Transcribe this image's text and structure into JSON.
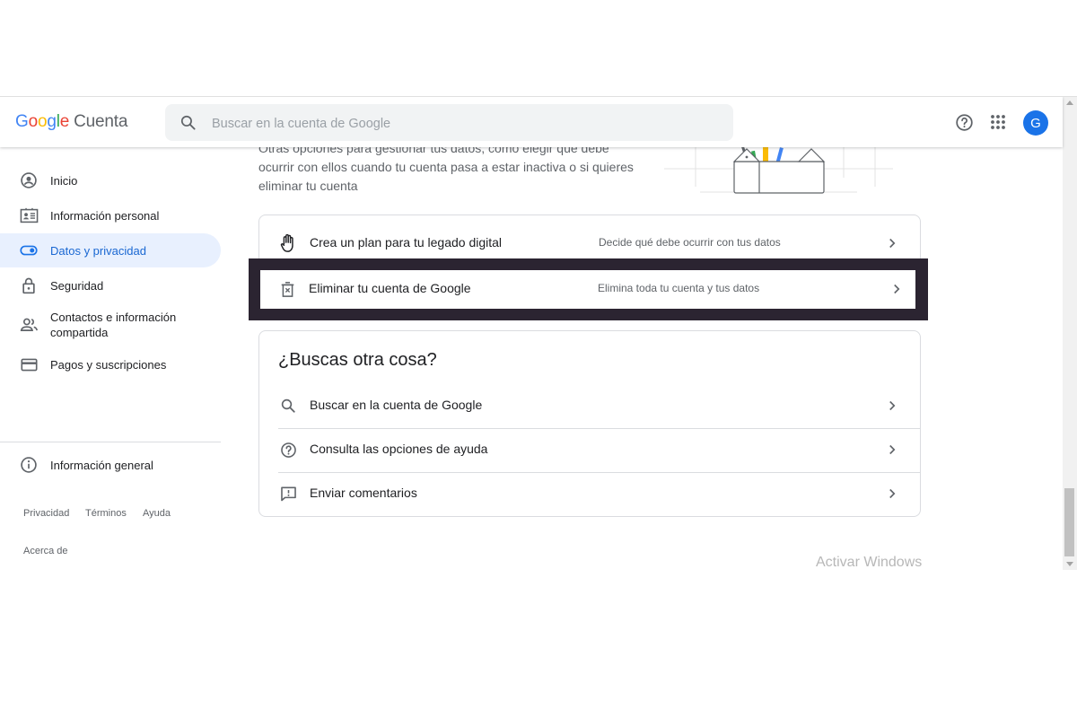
{
  "header": {
    "logo_google": [
      "G",
      "o",
      "o",
      "g",
      "l",
      "e"
    ],
    "logo_product": "Cuenta",
    "search_placeholder": "Buscar en la cuenta de Google",
    "avatar_letter": "G",
    "icons": [
      "help-icon",
      "apps-grid-icon"
    ]
  },
  "sidebar": {
    "items": [
      {
        "label": "Inicio",
        "icon": "account-circle-icon"
      },
      {
        "label": "Información personal",
        "icon": "id-card-icon"
      },
      {
        "label": "Datos y privacidad",
        "icon": "toggle-icon",
        "active": true
      },
      {
        "label": "Seguridad",
        "icon": "lock-icon"
      },
      {
        "label": "Contactos e información compartida",
        "icon": "people-icon"
      },
      {
        "label": "Pagos y suscripciones",
        "icon": "credit-card-icon"
      },
      {
        "label": "Información general",
        "icon": "info-icon"
      }
    ],
    "footer": {
      "privacy": "Privacidad",
      "terms": "Términos",
      "help": "Ayuda",
      "about": "Acerca de"
    }
  },
  "main": {
    "intro_text": "Otras opciones para gestionar tus datos, como elegir qué debe ocurrir con ellos cuando tu cuenta pasa a estar inactiva o si quieres eliminar tu cuenta",
    "options": [
      {
        "title": "Crea un plan para tu legado digital",
        "desc": "Decide qué debe ocurrir con tus datos",
        "icon": "hand-icon"
      },
      {
        "title": "Eliminar tu cuenta de Google",
        "desc": "Elimina toda tu cuenta y tus datos",
        "icon": "delete-icon"
      }
    ],
    "other": {
      "title": "¿Buscas otra cosa?",
      "items": [
        {
          "label": "Buscar en la cuenta de Google",
          "icon": "search-icon"
        },
        {
          "label": "Consulta las opciones de ayuda",
          "icon": "help-icon"
        },
        {
          "label": "Enviar comentarios",
          "icon": "feedback-icon"
        }
      ]
    }
  },
  "watermark": "Activar Windows",
  "colors": {
    "accent": "#1a73e8",
    "active_bg": "#e8f0fe",
    "active_text": "#1967d2",
    "highlight_border": "#2b2431"
  }
}
